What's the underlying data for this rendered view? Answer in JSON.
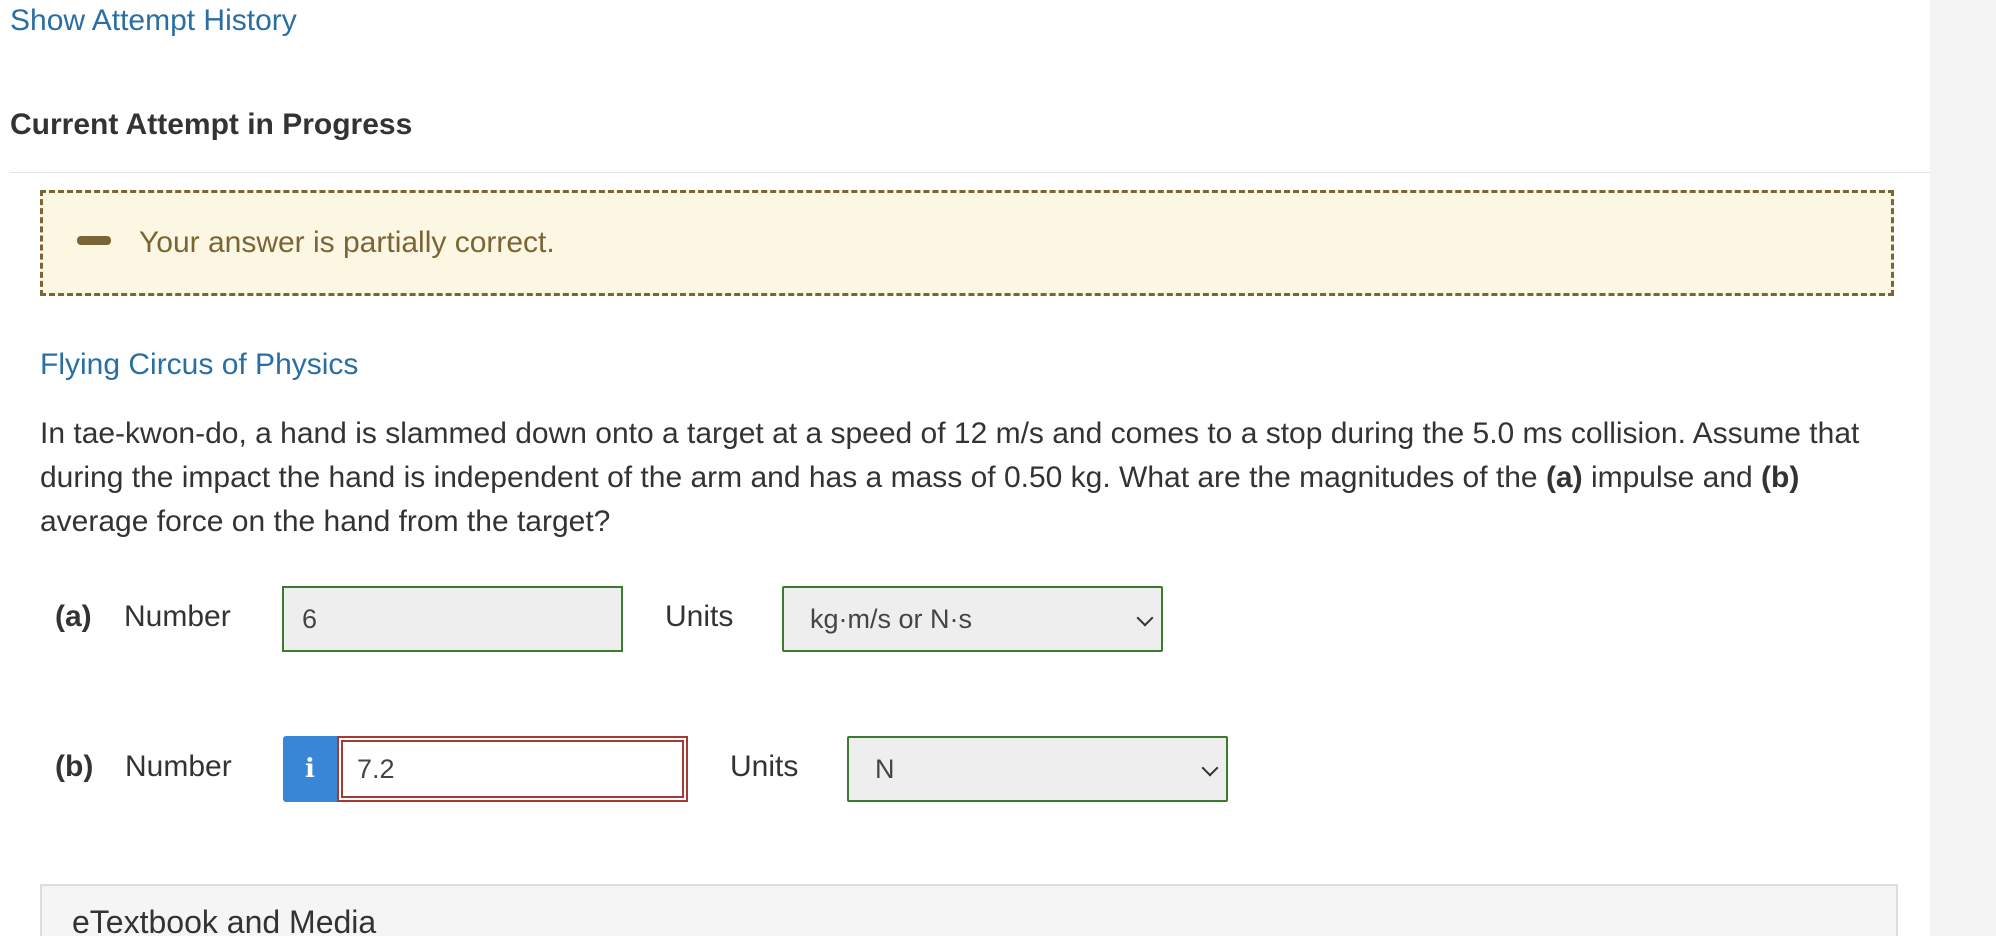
{
  "header": {
    "history_link": "Show Attempt History",
    "attempt_title": "Current Attempt in Progress"
  },
  "feedback": {
    "text": "Your answer is partially correct.",
    "icon": "minus-icon",
    "color": "#7a6535",
    "background": "#fbf7e3"
  },
  "question": {
    "source": "Flying Circus of Physics",
    "text_1": "In tae-kwon-do, a hand is slammed down onto a target at a speed of 12 m/s and comes to a stop during the 5.0 ms collision. Assume that during the impact the hand is independent of the arm and has a mass of 0.50 kg. What are the magnitudes of the ",
    "part_a_marker": "(a)",
    "text_2": " impulse and ",
    "part_b_marker": "(b)",
    "text_3": " average force on the hand from the target?"
  },
  "part_a": {
    "label": "(a)",
    "number_label": "Number",
    "value": "6",
    "units_label": "Units",
    "units_selected": "kg·m/s or N·s",
    "status_color": "#3c7a2e"
  },
  "part_b": {
    "label": "(b)",
    "number_label": "Number",
    "info_glyph": "i",
    "info_icon": "info-icon",
    "value": "7.2",
    "units_label": "Units",
    "units_selected": "N",
    "status_color": "#a43a33"
  },
  "etextbook": {
    "title": "eTextbook and Media"
  },
  "colors": {
    "link": "#2a6fa3",
    "correct_border": "#3c7a2e",
    "incorrect_border": "#a43a33",
    "info_button": "#3a86d6"
  }
}
